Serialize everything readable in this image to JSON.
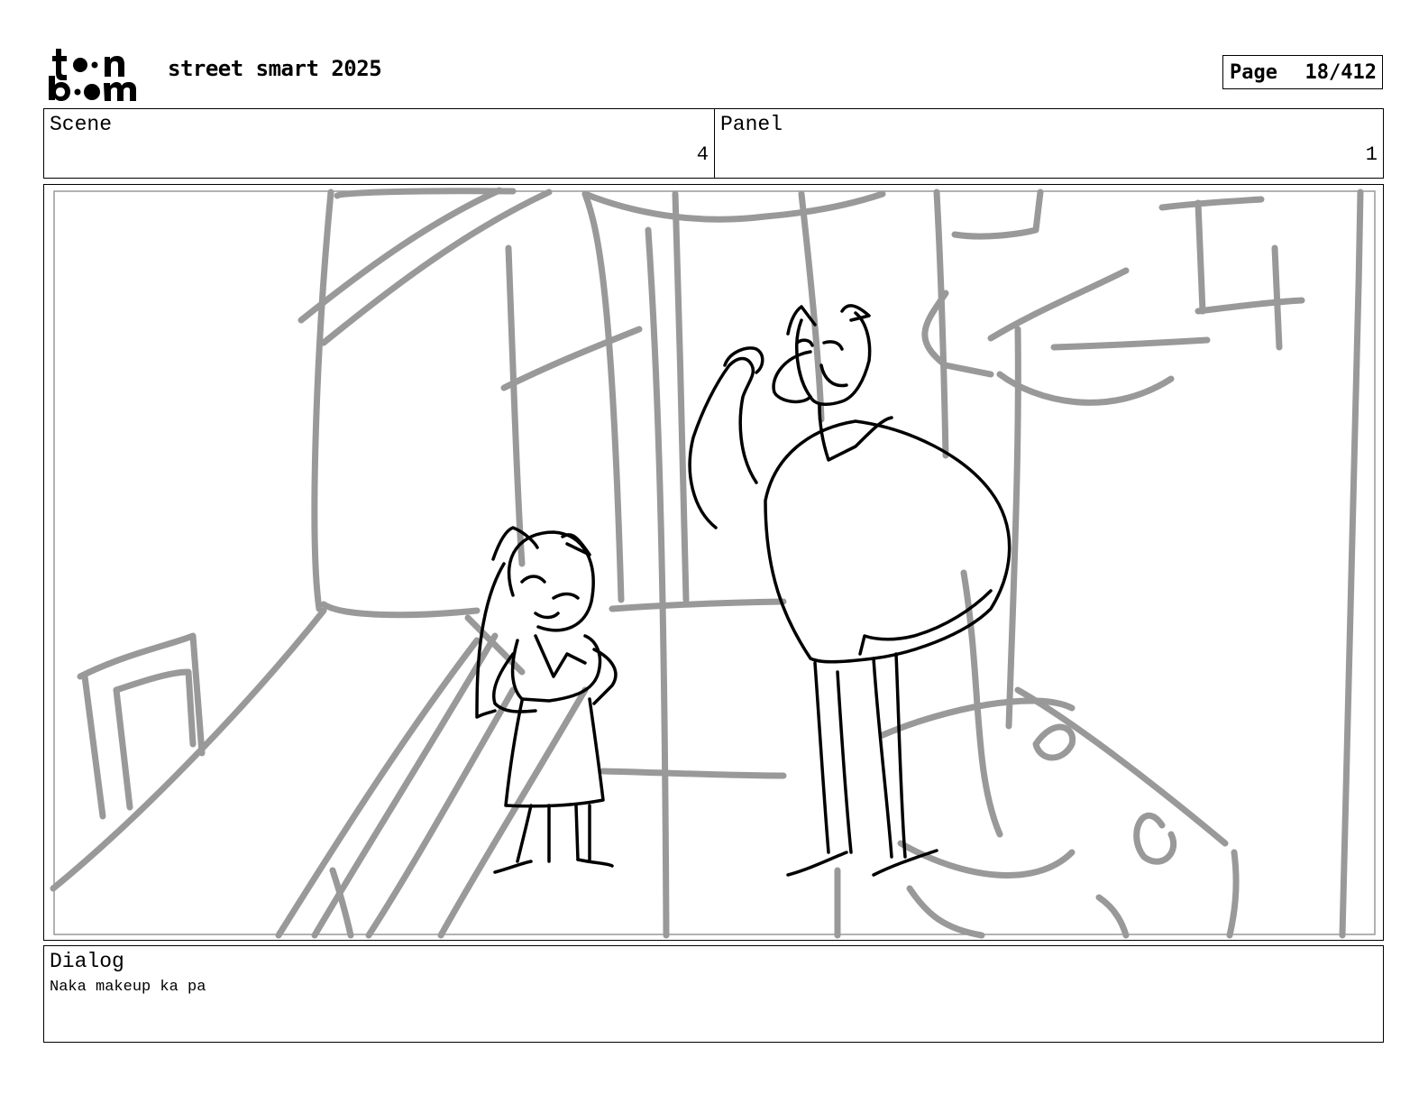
{
  "header": {
    "logo_name": "toon boom",
    "project_title": "street smart 2025",
    "page": {
      "label": "Page",
      "value": "18/412"
    }
  },
  "scene": {
    "label": "Scene",
    "value": "4"
  },
  "panel": {
    "label": "Panel",
    "value": "1"
  },
  "dialog": {
    "label": "Dialog",
    "text": "Naka makeup ka pa"
  },
  "colors": {
    "rough_sketch": "#999999",
    "ink": "#000000"
  }
}
